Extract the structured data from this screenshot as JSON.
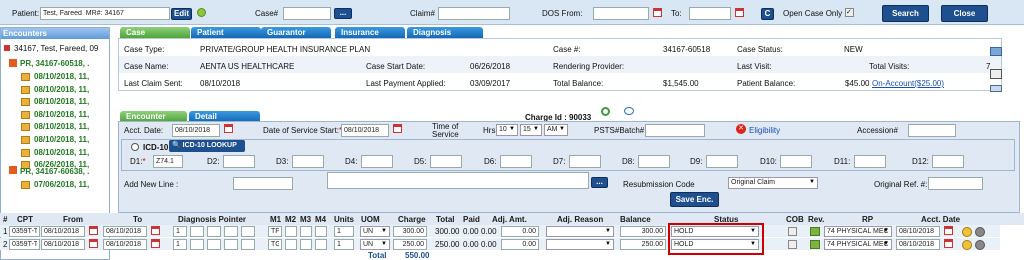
{
  "topbar": {
    "patient_label": "Patient:",
    "patient_value": "Test, Fareed  MR#: 34167",
    "edit": "Edit",
    "case_label": "Case#",
    "claim_label": "Claim#",
    "dos_from_label": "DOS From:",
    "to_label": "To:",
    "c_btn": "C",
    "open_case_only": "Open Case Only",
    "search": "Search",
    "close": "Close"
  },
  "sidebar": {
    "title": "Encounters",
    "patient": "34167, Test, Fareed, 09",
    "case1": "PR, 34167-60518, .",
    "dates1": [
      "08/10/2018, 11,",
      "08/10/2018, 11,",
      "08/10/2018, 11,",
      "08/10/2018, 11,",
      "08/10/2018, 11,",
      "08/10/2018, 11,",
      "08/10/2018, 11,",
      "06/26/2018, 11,"
    ],
    "case2": "PR, 34167-60638, .",
    "dates2": [
      "07/06/2018, 11,"
    ]
  },
  "case_tabs": [
    "Case",
    "Patient",
    "Guarantor",
    "Insurance",
    "Diagnosis"
  ],
  "case": {
    "type_label": "Case Type:",
    "type": "PRIVATE/GROUP HEALTH INSURANCE PLAN",
    "case_num_label": "Case #:",
    "case_num": "34167-60518",
    "status_label": "Case Status:",
    "status": "NEW",
    "name_label": "Case Name:",
    "name": "AENTA US HEALTHCARE",
    "start_label": "Case Start Date:",
    "start": "06/26/2018",
    "rendering_label": "Rendering Provider:",
    "last_visit_label": "Last Visit:",
    "visits": "7",
    "claim_sent_label": "Last Claim Sent:",
    "claim_sent": "08/10/2018",
    "total_visits_label": "Total Visits:",
    "payment_label": "Last Payment Applied:",
    "payment": "03/09/2017",
    "balance_label": "Total Balance:",
    "balance": "$1,545.00",
    "pat_bal_label": "Patient Balance:",
    "pat_bal": "$45.00",
    "on_account": "On-Account($25.00)"
  },
  "enc_tabs": [
    "Encounter",
    "Detail"
  ],
  "charge_id": "Charge Id : 90033",
  "enc": {
    "acct_label": "Acct. Date:",
    "acct": "08/10/2018",
    "dos_label": "Date of Service Start:",
    "dos": "08/10/2018",
    "time_label1": "Time of",
    "time_label2": "Service",
    "hrs": "Hrs",
    "hr": "10",
    "min": "15",
    "ampm": "AM",
    "psts": "PSTS#Batch#",
    "eligibility": "Eligibility",
    "accession": "Accession#",
    "icd": "ICD-10",
    "icd_lookup": "ICD-10 LOOKUP",
    "d1": "D1:",
    "d1_val": "Z74.1",
    "dlabels": [
      "D2:",
      "D3:",
      "D4:",
      "D5:",
      "D6:",
      "D7:",
      "D8:",
      "D9:",
      "D10:",
      "D11:",
      "D12:"
    ],
    "add_line": "Add New Line :",
    "resub_label": "Resubmission Code",
    "resub": "Original Claim",
    "orig_ref": "Original Ref. #:",
    "save": "Save Enc.",
    "ellipsis": "..."
  },
  "table": {
    "headers": [
      "#",
      "CPT",
      "From",
      "To",
      "Diagnosis Pointer",
      "M1",
      "M2",
      "M3",
      "M4",
      "Units",
      "UOM",
      "Charge",
      "Total",
      "Paid",
      "Adj. Amt.",
      "Adj. Reason",
      "Balance",
      "Status",
      "COB",
      "Rev.",
      "RP",
      "Acct. Date"
    ],
    "rows": [
      {
        "n": "1",
        "cpt": "0359T-TI",
        "from": "08/10/2018",
        "to": "08/10/2018",
        "ptr": "1",
        "m1": "TF",
        "units": "1",
        "uom": "UN",
        "charge": "300.00",
        "total": "300.00",
        "paid": "0.00",
        "paid2": "0.00",
        "adj": "0.00",
        "balance": "300.00",
        "status": "HOLD",
        "rev": "74",
        "rp": "PHYSICAL MEC",
        "acct": "08/10/2018"
      },
      {
        "n": "2",
        "cpt": "0359T-TI",
        "from": "08/10/2018",
        "to": "08/10/2018",
        "ptr": "1",
        "m1": "TG",
        "units": "1",
        "uom": "UN",
        "charge": "250.00",
        "total": "250.00",
        "paid": "0.00",
        "paid2": "0.00",
        "adj": "0.00",
        "balance": "250.00",
        "status": "HOLD",
        "rev": "74",
        "rp": "PHYSICAL MEC",
        "acct": "08/10/2018"
      }
    ],
    "total_label": "Total",
    "total": "550.00"
  },
  "colors": {
    "nav_blue": "#1e4f8f",
    "highlight": "#d00000"
  }
}
